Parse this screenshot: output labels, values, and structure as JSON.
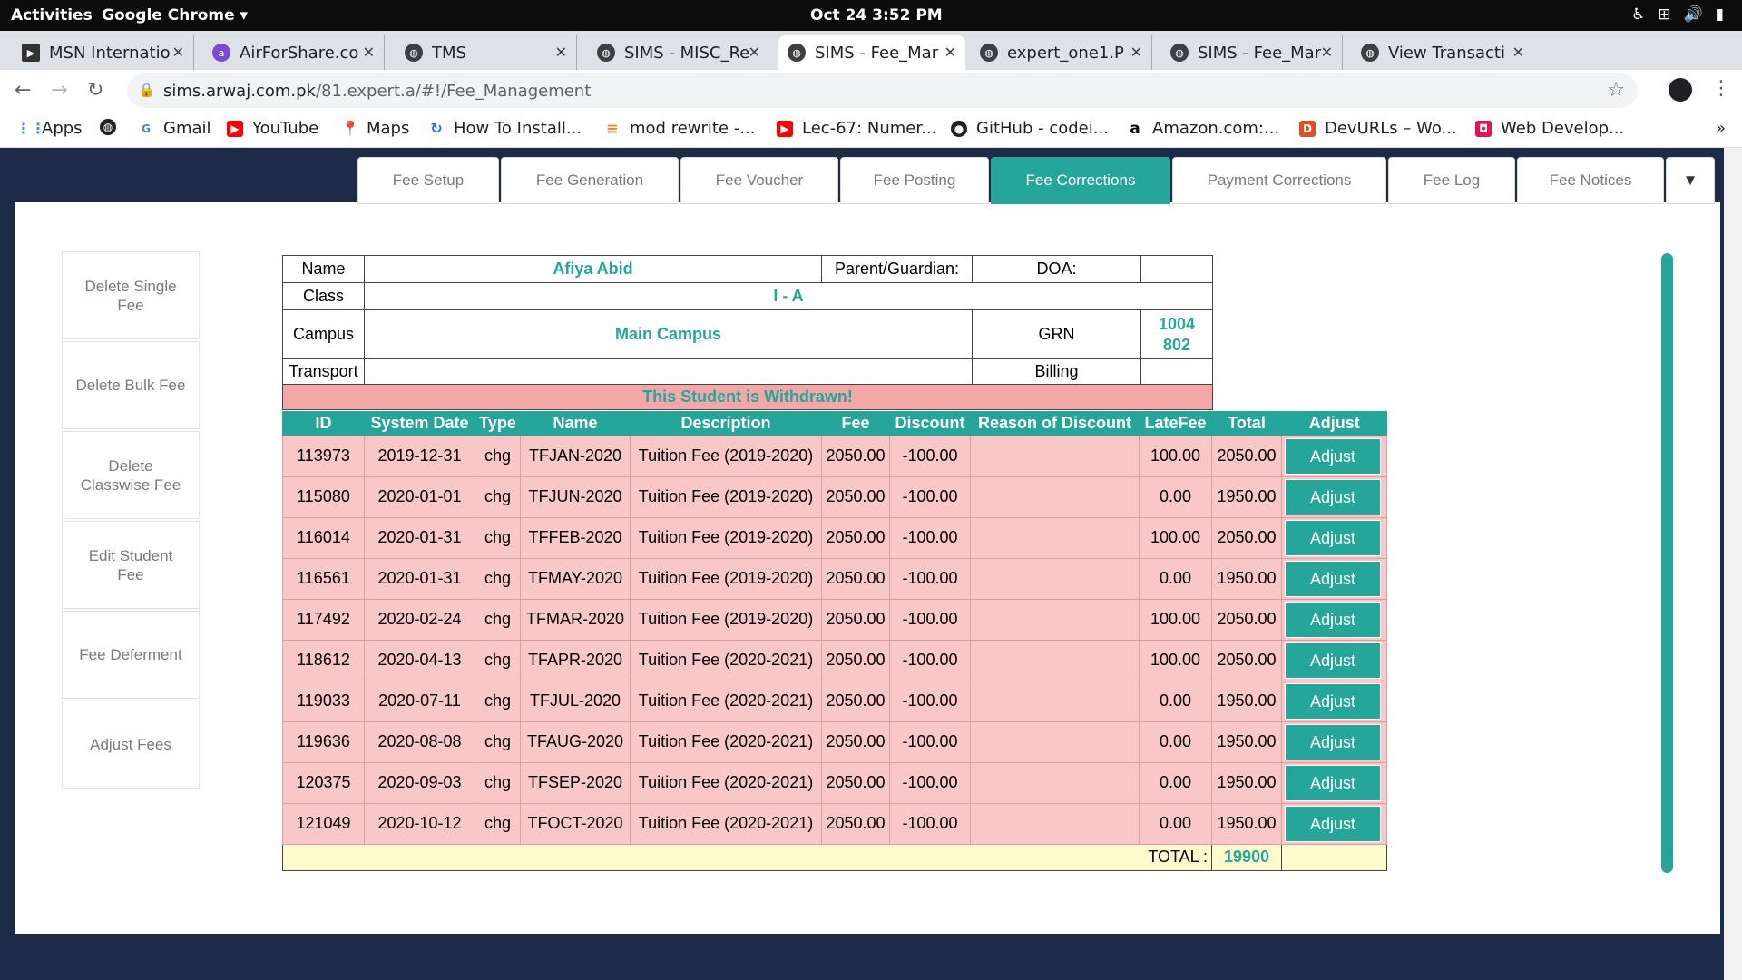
{
  "os_bar": {
    "activities": "Activities",
    "app_name": "Google Chrome ▾",
    "clock": "Oct 24  3:52 PM"
  },
  "browser": {
    "tabs": [
      {
        "label": "MSN Internatio",
        "icon": "msn-icon"
      },
      {
        "label": "AirForShare.co",
        "icon": "airforshare-icon"
      },
      {
        "label": "TMS",
        "icon": "globe-icon"
      },
      {
        "label": "SIMS - MISC_Re",
        "icon": "globe-icon"
      },
      {
        "label": "SIMS - Fee_Mar",
        "icon": "globe-icon",
        "active": true
      },
      {
        "label": "expert_one1.P",
        "icon": "globe-icon"
      },
      {
        "label": "SIMS - Fee_Mar",
        "icon": "globe-icon"
      },
      {
        "label": "View Transacti",
        "icon": "globe-icon"
      }
    ],
    "url_host": "sims.arwaj.com.pk",
    "url_path": "/81.expert.a/#!/Fee_Management",
    "bookmarks": [
      {
        "label": "Apps",
        "icon": "apps-grid-icon"
      },
      {
        "label": "",
        "icon": "globe-icon"
      },
      {
        "label": "Gmail",
        "icon": "google-icon"
      },
      {
        "label": "YouTube",
        "icon": "youtube-icon"
      },
      {
        "label": "Maps",
        "icon": "maps-icon"
      },
      {
        "label": "How To Install...",
        "icon": "install-icon"
      },
      {
        "label": "mod rewrite -...",
        "icon": "stackoverflow-icon"
      },
      {
        "label": "Lec-67: Numer...",
        "icon": "youtube-icon"
      },
      {
        "label": "GitHub - codei...",
        "icon": "github-icon"
      },
      {
        "label": "Amazon.com:...",
        "icon": "amazon-icon"
      },
      {
        "label": "DevURLs – Wo...",
        "icon": "devurls-icon"
      },
      {
        "label": "Web Develop...",
        "icon": "webdev-icon"
      }
    ]
  },
  "fee_nav": {
    "tabs": [
      {
        "label": "Fee Setup"
      },
      {
        "label": "Fee Generation"
      },
      {
        "label": "Fee Voucher"
      },
      {
        "label": "Fee Posting"
      },
      {
        "label": "Fee Corrections",
        "active": true
      },
      {
        "label": "Payment Corrections"
      },
      {
        "label": "Fee Log"
      },
      {
        "label": "Fee Notices"
      }
    ]
  },
  "side_menu": [
    {
      "label": "Delete Single Fee"
    },
    {
      "label": "Delete Bulk Fee"
    },
    {
      "label": "Delete Classwise Fee"
    },
    {
      "label": "Edit Student Fee"
    },
    {
      "label": "Fee Deferment"
    },
    {
      "label": "Adjust Fees"
    }
  ],
  "student": {
    "name_label": "Name",
    "name": "Afiya Abid",
    "parent_label": "Parent/Guardian:",
    "doa_label": "DOA:",
    "class_label": "Class",
    "class": "I - A",
    "campus_label": "Campus",
    "campus": "Main Campus",
    "grn_label": "GRN",
    "grn": "1004\n802",
    "transport_label": "Transport",
    "billing_label": "Billing",
    "status_message": "This Student is Withdrawn!"
  },
  "fee_table": {
    "headers": [
      "ID",
      "System Date",
      "Type",
      "Name",
      "Description",
      "Fee",
      "Discount",
      "Reason of Discount",
      "LateFee",
      "Total",
      "Adjust"
    ],
    "rows": [
      [
        "113973",
        "2019-12-31",
        "chg",
        "TFJAN-2020",
        "Tuition Fee (2019-2020)",
        "2050.00",
        "-100.00",
        "",
        "100.00",
        "2050.00"
      ],
      [
        "115080",
        "2020-01-01",
        "chg",
        "TFJUN-2020",
        "Tuition Fee (2019-2020)",
        "2050.00",
        "-100.00",
        "",
        "0.00",
        "1950.00"
      ],
      [
        "116014",
        "2020-01-31",
        "chg",
        "TFFEB-2020",
        "Tuition Fee (2019-2020)",
        "2050.00",
        "-100.00",
        "",
        "100.00",
        "2050.00"
      ],
      [
        "116561",
        "2020-01-31",
        "chg",
        "TFMAY-2020",
        "Tuition Fee (2019-2020)",
        "2050.00",
        "-100.00",
        "",
        "0.00",
        "1950.00"
      ],
      [
        "117492",
        "2020-02-24",
        "chg",
        "TFMAR-2020",
        "Tuition Fee (2019-2020)",
        "2050.00",
        "-100.00",
        "",
        "100.00",
        "2050.00"
      ],
      [
        "118612",
        "2020-04-13",
        "chg",
        "TFAPR-2020",
        "Tuition Fee (2020-2021)",
        "2050.00",
        "-100.00",
        "",
        "100.00",
        "2050.00"
      ],
      [
        "119033",
        "2020-07-11",
        "chg",
        "TFJUL-2020",
        "Tuition Fee (2020-2021)",
        "2050.00",
        "-100.00",
        "",
        "0.00",
        "1950.00"
      ],
      [
        "119636",
        "2020-08-08",
        "chg",
        "TFAUG-2020",
        "Tuition Fee (2020-2021)",
        "2050.00",
        "-100.00",
        "",
        "0.00",
        "1950.00"
      ],
      [
        "120375",
        "2020-09-03",
        "chg",
        "TFSEP-2020",
        "Tuition Fee (2020-2021)",
        "2050.00",
        "-100.00",
        "",
        "0.00",
        "1950.00"
      ],
      [
        "121049",
        "2020-10-12",
        "chg",
        "TFOCT-2020",
        "Tuition Fee (2020-2021)",
        "2050.00",
        "-100.00",
        "",
        "0.00",
        "1950.00"
      ]
    ],
    "adjust_label": "Adjust",
    "total_label": "TOTAL :",
    "total_value": "19900"
  },
  "colors": {
    "accent": "#26a69a",
    "row_bg": "#f9c7c7",
    "withdrawn_bg": "#f4a7a7",
    "total_bg": "#fffbcc"
  }
}
